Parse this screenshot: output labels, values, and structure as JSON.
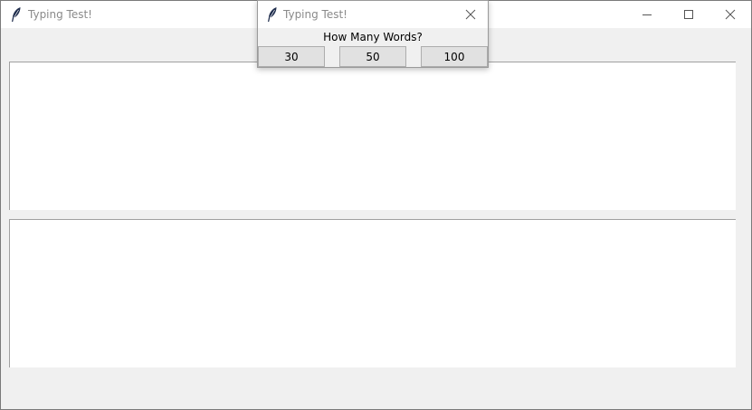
{
  "main_window": {
    "title": "Typing Test!",
    "controls": {
      "minimize_icon": "minimize-icon",
      "maximize_icon": "maximize-icon",
      "close_icon": "close-icon"
    },
    "text_areas": [
      {
        "value": ""
      },
      {
        "value": ""
      }
    ]
  },
  "popup": {
    "title": "Typing Test!",
    "prompt": "How Many Words?",
    "buttons": [
      {
        "label": "30"
      },
      {
        "label": "50"
      },
      {
        "label": "100"
      }
    ]
  },
  "colors": {
    "window_bg": "#f0f0f0",
    "titlebar_bg": "#ffffff",
    "title_text": "#8a8a8a",
    "button_bg": "#e1e1e1",
    "button_border": "#adadad",
    "feather_icon": "#1f2d4d"
  }
}
